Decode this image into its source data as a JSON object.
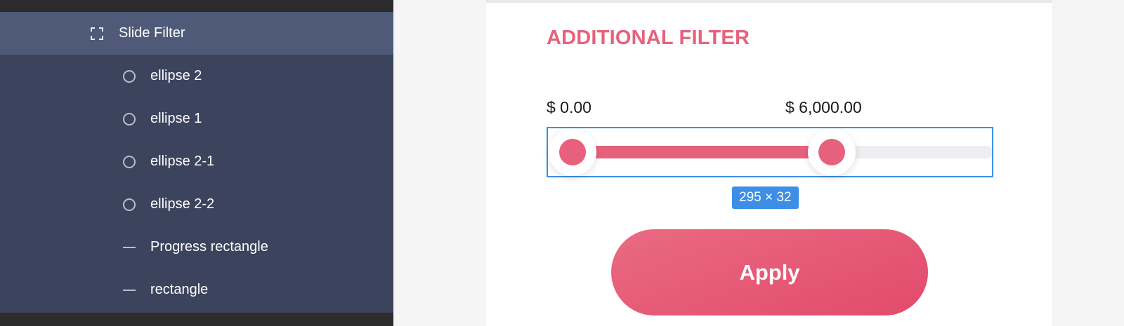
{
  "layers": {
    "items": [
      {
        "label": "Slide Filter",
        "icon": "frame-icon",
        "selected": true
      },
      {
        "label": "ellipse 2",
        "icon": "ellipse-icon",
        "selected": false
      },
      {
        "label": "ellipse 1",
        "icon": "ellipse-icon",
        "selected": false
      },
      {
        "label": "ellipse 2-1",
        "icon": "ellipse-icon",
        "selected": false
      },
      {
        "label": "ellipse 2-2",
        "icon": "ellipse-icon",
        "selected": false
      },
      {
        "label": "Progress rectangle",
        "icon": "line-icon",
        "selected": false
      },
      {
        "label": "rectangle",
        "icon": "line-icon",
        "selected": false
      }
    ]
  },
  "design": {
    "title": "ADDITIONAL FILTER",
    "price_min_label": "$ 0.00",
    "price_max_label": "$ 6,000.00",
    "slider": {
      "min_fraction": 0.0,
      "max_fraction": 0.6
    },
    "selection_size": "295 × 32",
    "apply_label": "Apply"
  },
  "colors": {
    "accent": "#e8617c",
    "selection": "#3d8fe6",
    "panel": "#3c435d",
    "panel_selected": "#4f5a78"
  }
}
